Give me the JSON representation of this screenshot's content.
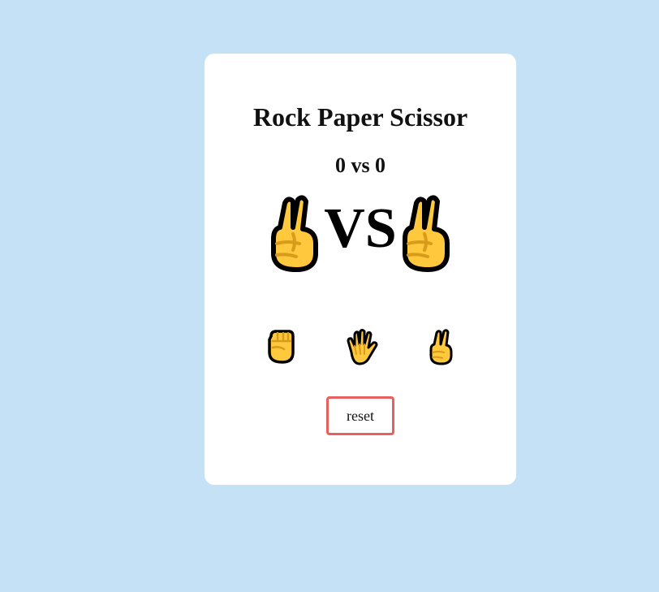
{
  "game": {
    "title": "Rock Paper Scissor",
    "score": "0 vs 0",
    "vs_label": "VS",
    "player_hand": "scissors-hand-icon",
    "computer_hand": "scissors-hand-icon"
  },
  "choices": [
    {
      "name": "rock",
      "icon": "rock-fist-icon"
    },
    {
      "name": "paper",
      "icon": "paper-hand-icon"
    },
    {
      "name": "scissors",
      "icon": "scissors-hand-icon"
    }
  ],
  "controls": {
    "reset_label": "reset"
  },
  "colors": {
    "background": "#c5e1f5",
    "card": "#ffffff",
    "reset_border": "#e8605e",
    "emoji_fill": "#ffc83d",
    "emoji_outline": "#000000"
  }
}
